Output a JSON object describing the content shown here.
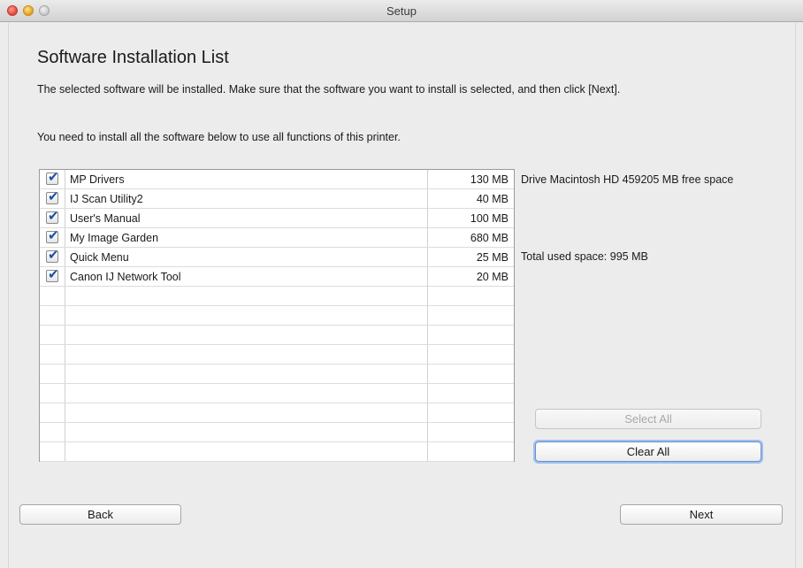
{
  "window": {
    "title": "Setup"
  },
  "page": {
    "title": "Software Installation List",
    "description_line1": "The selected software will be installed. Make sure that the software you want to install is selected, and then click [Next].",
    "description_line2": "You need to install all the software below to use all functions of this printer."
  },
  "software_list": {
    "items": [
      {
        "name": "MP Drivers",
        "size": "130 MB",
        "checked": true
      },
      {
        "name": "IJ Scan Utility2",
        "size": "40 MB",
        "checked": true
      },
      {
        "name": "User's Manual",
        "size": "100 MB",
        "checked": true
      },
      {
        "name": "My Image Garden",
        "size": "680 MB",
        "checked": true
      },
      {
        "name": "Quick Menu",
        "size": "25 MB",
        "checked": true
      },
      {
        "name": "Canon IJ Network Tool",
        "size": "20 MB",
        "checked": true
      }
    ],
    "check_glyph": "✔"
  },
  "disk": {
    "drive_info": "Drive Macintosh HD 459205 MB free space",
    "total_used": "Total used space: 995 MB"
  },
  "buttons": {
    "select_all": "Select All",
    "clear_all": "Clear All",
    "back": "Back",
    "next": "Next"
  },
  "colors": {
    "checkmark": "#1d4fa8",
    "focus_ring": "#9fc0ef"
  }
}
